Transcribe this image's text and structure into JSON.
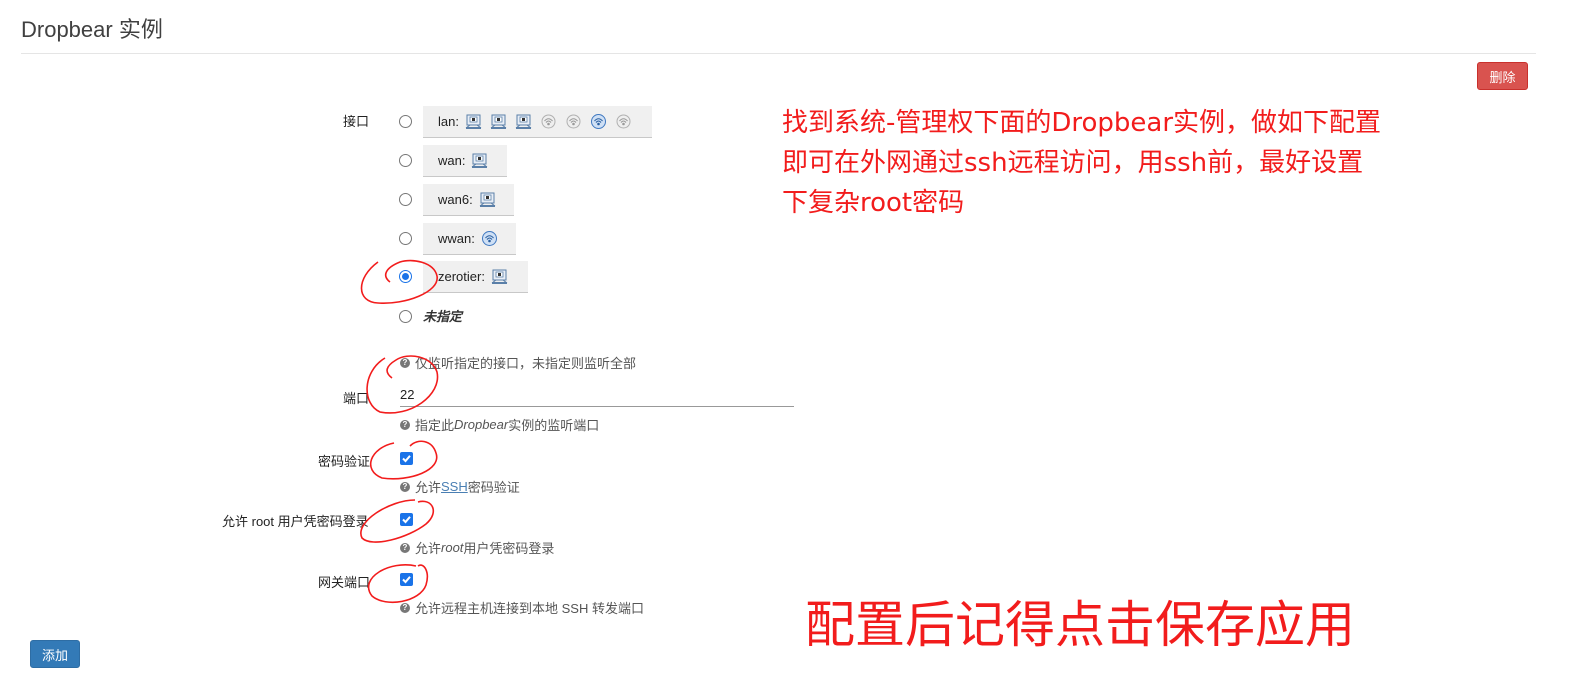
{
  "page": {
    "title": "Dropbear 实例"
  },
  "buttons": {
    "delete": "删除",
    "add": "添加"
  },
  "interface": {
    "label": "接口",
    "options": [
      {
        "name": "lan:",
        "icons": [
          "network-icon",
          "network-icon",
          "network-icon",
          "wireless-off-icon",
          "wireless-off-icon",
          "wireless-icon",
          "wireless-off-icon"
        ],
        "selected": false
      },
      {
        "name": "wan:",
        "icons": [
          "network-icon"
        ],
        "selected": false
      },
      {
        "name": "wan6:",
        "icons": [
          "network-icon"
        ],
        "selected": false
      },
      {
        "name": "wwan:",
        "icons": [
          "wireless-icon"
        ],
        "selected": false
      },
      {
        "name": "zerotier:",
        "icons": [
          "network-icon"
        ],
        "selected": true
      }
    ],
    "unspecified": "未指定",
    "help": "仅监听指定的接口，未指定则监听全部"
  },
  "port": {
    "label": "端口",
    "value": "22",
    "help_prefix": "指定此 ",
    "help_italic": "Dropbear",
    "help_suffix": " 实例的监听端口"
  },
  "password_auth": {
    "label": "密码验证",
    "checked": true,
    "help_prefix": "允许 ",
    "help_link": "SSH",
    "help_suffix": " 密码验证"
  },
  "root_login": {
    "label": "允许 root 用户凭密码登录",
    "checked": true,
    "help_prefix": "允许 ",
    "help_italic": "root",
    "help_suffix": " 用户凭密码登录"
  },
  "gateway_ports": {
    "label": "网关端口",
    "checked": true,
    "help": "允许远程主机连接到本地 SSH 转发端口"
  },
  "annotations": {
    "note_lines": [
      "找到系统-管理权下面的Dropbear实例，做如下配置",
      "即可在外网通过ssh远程访问，用ssh前，最好设置",
      "下复杂root密码"
    ],
    "reminder": "配置后记得点击保存应用"
  },
  "colors": {
    "annotation": "#f21c1c",
    "delete": "#d9534f",
    "add": "#337ab7",
    "check": "#1a73e8"
  }
}
